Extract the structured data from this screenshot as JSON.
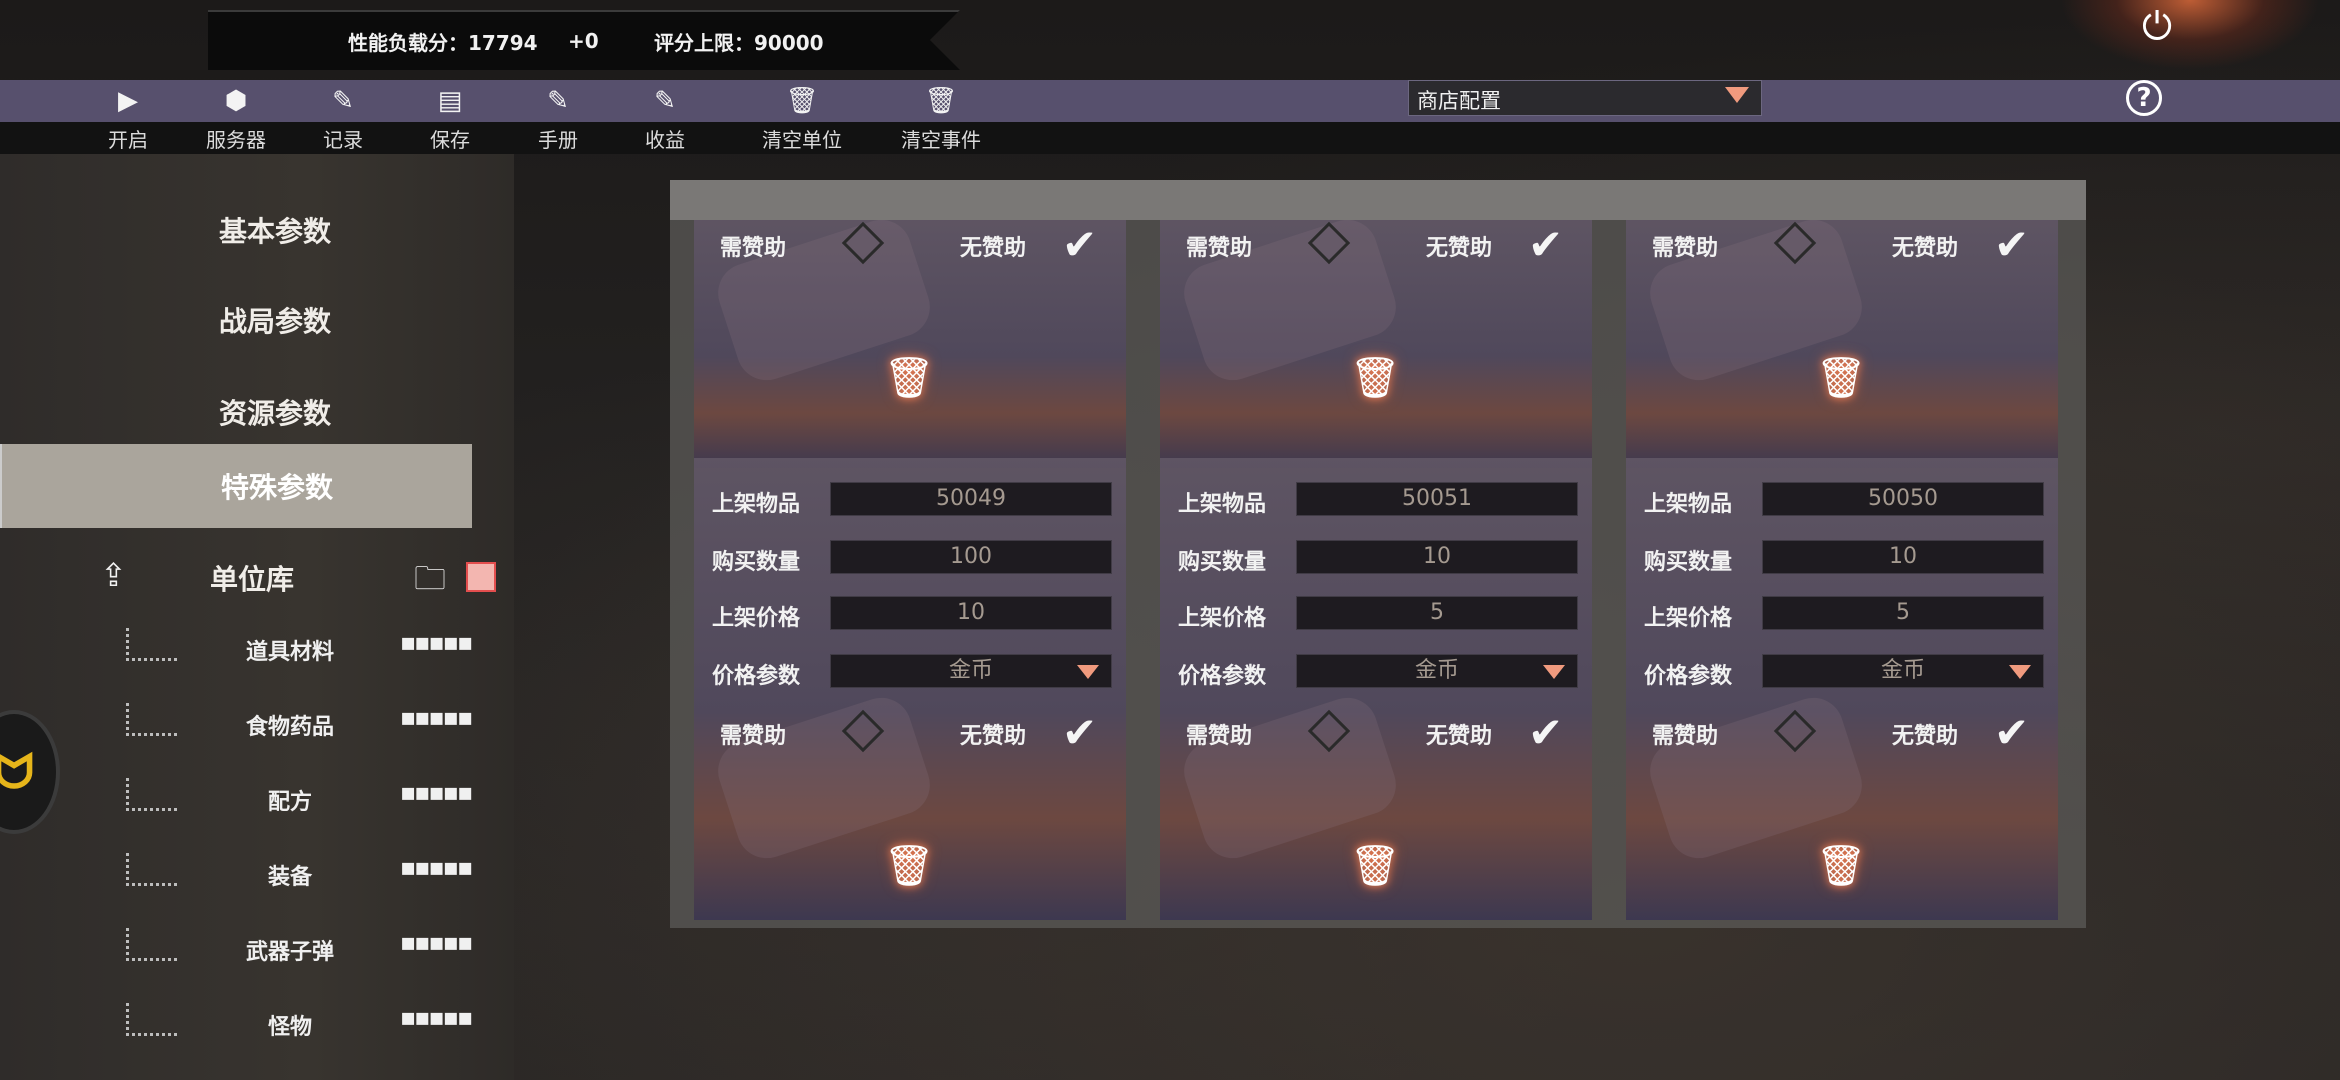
{
  "header": {
    "perf_load": "性能负载分：17794",
    "perf_delta": "+0",
    "score_limit": "评分上限：90000"
  },
  "toolbar": {
    "items": [
      {
        "label": "开启",
        "icon": "play-icon"
      },
      {
        "label": "服务器",
        "icon": "cube-icon"
      },
      {
        "label": "记录",
        "icon": "edit-icon"
      },
      {
        "label": "保存",
        "icon": "save-icon"
      },
      {
        "label": "手册",
        "icon": "edit-icon"
      },
      {
        "label": "收益",
        "icon": "edit-icon"
      },
      {
        "label": "清空单位",
        "icon": "trash-icon"
      },
      {
        "label": "清空事件",
        "icon": "trash-icon"
      }
    ],
    "config_select": "商店配置",
    "help": "?"
  },
  "sidebar": {
    "nav": [
      "基本参数",
      "战局参数",
      "资源参数",
      "特殊参数"
    ],
    "active_index": 3,
    "library_title": "单位库",
    "library_items": [
      "道具材料",
      "食物药品",
      "配方",
      "装备",
      "武器子弹",
      "怪物"
    ],
    "more_glyph": "▪▪▪▪▪"
  },
  "labels": {
    "item": "上架物品",
    "quantity": "购买数量",
    "price": "上架价格",
    "price_param": "价格参数",
    "need_sponsor": "需赞助",
    "no_sponsor": "无赞助"
  },
  "cards_top": [
    {
      "no_sponsor_checked": true
    },
    {
      "no_sponsor_checked": true
    },
    {
      "no_sponsor_checked": true
    }
  ],
  "cards": [
    {
      "item": "50049",
      "quantity": "100",
      "price": "10",
      "currency": "金币",
      "no_sponsor_checked": true
    },
    {
      "item": "50051",
      "quantity": "10",
      "price": "5",
      "currency": "金币",
      "no_sponsor_checked": true
    },
    {
      "item": "50050",
      "quantity": "10",
      "price": "5",
      "currency": "金币",
      "no_sponsor_checked": true
    }
  ],
  "colors": {
    "toolbar": "#57506d",
    "accent": "#f09a7e",
    "active_nav": "#aaa59c"
  }
}
